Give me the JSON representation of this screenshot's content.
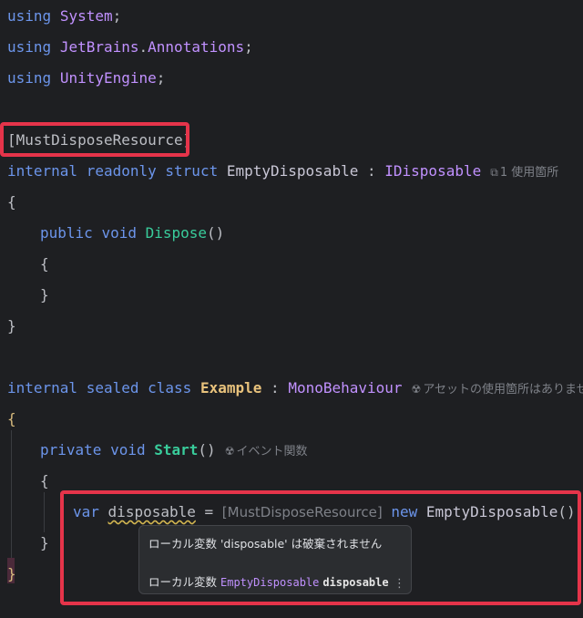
{
  "code": {
    "l1": {
      "kw": "using",
      "ns": "System",
      "end": ";"
    },
    "l2": {
      "kw": "using",
      "ns1": "JetBrains",
      "dot": ".",
      "ns2": "Annotations",
      "end": ";"
    },
    "l3": {
      "kw": "using",
      "ns": "UnityEngine",
      "end": ";"
    },
    "l5": {
      "attr": "[MustDisposeResource]"
    },
    "l6": {
      "kw1": "internal",
      "kw2": "readonly",
      "kw3": "struct",
      "name": "EmptyDisposable",
      "colon": ":",
      "iface": "IDisposable",
      "hint": "1 使用箇所"
    },
    "l7": {
      "brace": "{"
    },
    "l8": {
      "kw1": "public",
      "kw2": "void",
      "fn": "Dispose",
      "paren": "()"
    },
    "l9": {
      "brace": "{"
    },
    "l10": {
      "brace": "}"
    },
    "l11": {
      "brace": "}"
    },
    "l13": {
      "kw1": "internal",
      "kw2": "sealed",
      "kw3": "class",
      "name": "Example",
      "colon": ":",
      "base": "MonoBehaviour",
      "hint": "アセットの使用箇所はありませ"
    },
    "l14": {
      "brace": "{"
    },
    "l15": {
      "kw1": "private",
      "kw2": "void",
      "fn": "Start",
      "paren": "()",
      "hint": "イベント関数"
    },
    "l16": {
      "brace": "{"
    },
    "l17": {
      "kw1": "var",
      "var": "disposable",
      "eq": "=",
      "inlay": "[MustDisposeResource]",
      "kw2": "new",
      "type": "EmptyDisposable",
      "end": "();"
    },
    "l18": {
      "brace": "}"
    },
    "l19": {
      "brace": "}"
    }
  },
  "popup": {
    "warning": "ローカル変数 'disposable' は破棄されません",
    "prefix": "ローカル変数",
    "type": "EmptyDisposable",
    "var": "disposable",
    "more": "⋮"
  },
  "colors": {
    "highlight_box": "#e5344a",
    "background": "#1e1f22"
  }
}
